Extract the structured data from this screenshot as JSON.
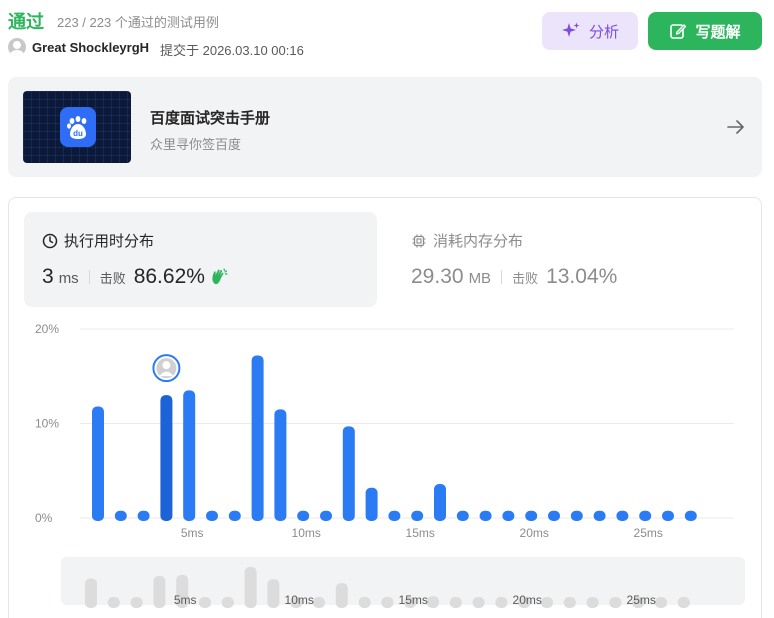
{
  "header": {
    "status": "通过",
    "count": "223 / 223 个通过的测试用例",
    "user": "Great ShockleyrgH",
    "submitted": "提交于 2026.03.10 00:16"
  },
  "buttons": {
    "analyze": "分析",
    "solution": "写题解"
  },
  "promo": {
    "logo_text": "du",
    "title": "百度面试突击手册",
    "subtitle": "众里寻你签百度"
  },
  "runtime": {
    "title": "执行用时分布",
    "value": "3",
    "unit": "ms",
    "beat_label": "击败",
    "beat_value": "86.62%"
  },
  "memory": {
    "title": "消耗内存分布",
    "value": "29.30",
    "unit": "MB",
    "beat_label": "击败",
    "beat_value": "13.04%"
  },
  "colors": {
    "accent": "#2db55d",
    "bar": "#2b7bf5",
    "bar_active": "#1d63d8",
    "purple": "#7c4ddf"
  },
  "chart_data": {
    "type": "bar",
    "x": [
      1,
      2,
      3,
      4,
      5,
      6,
      7,
      8,
      9,
      10,
      11,
      12,
      13,
      14,
      15,
      16,
      17,
      18,
      19,
      20,
      21,
      22,
      23,
      24,
      25,
      26,
      27
    ],
    "values": [
      11.8,
      0.5,
      0.5,
      13.0,
      13.5,
      0.7,
      0.9,
      17.2,
      11.5,
      0.5,
      0.9,
      9.7,
      3.2,
      0.5,
      0.5,
      3.6,
      0.5,
      0.5,
      0.5,
      0.5,
      0.5,
      0.5,
      0.5,
      0.5,
      0.5,
      0.5,
      0.5
    ],
    "highlight_x": 4,
    "xticks": [
      5,
      10,
      15,
      20,
      25
    ],
    "xtick_labels": [
      "5ms",
      "10ms",
      "15ms",
      "20ms",
      "25ms"
    ],
    "yticks": [
      0,
      10,
      20
    ],
    "ytick_labels": [
      "0%",
      "10%",
      "20%"
    ],
    "ylim": [
      0,
      20
    ],
    "grid": true
  }
}
